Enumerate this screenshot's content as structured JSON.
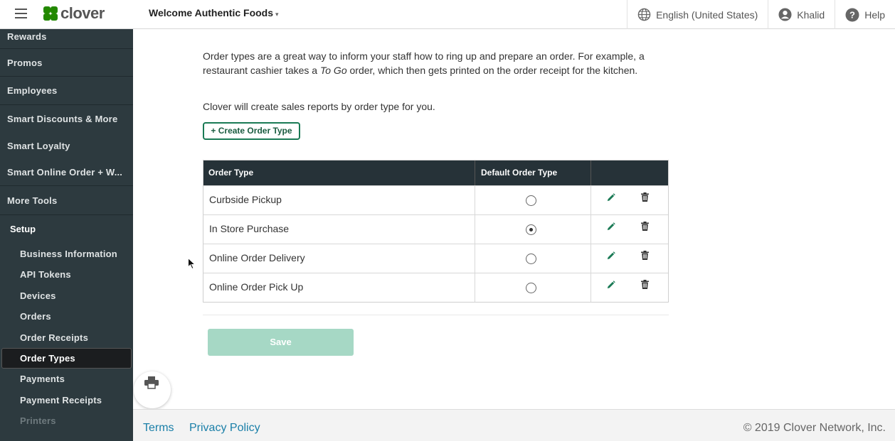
{
  "header": {
    "brand": "clover",
    "merchant_name": "Welcome Authentic Foods",
    "language": "English (United States)",
    "user": "Khalid",
    "help": "Help"
  },
  "sidebar": {
    "items": [
      {
        "label": "Rewards"
      },
      {
        "label": "Promos"
      },
      {
        "label": "Employees"
      },
      {
        "label": "Smart Discounts & More"
      },
      {
        "label": "Smart Loyalty"
      },
      {
        "label": "Smart Online Order + W..."
      },
      {
        "label": "More Tools"
      }
    ],
    "setup": {
      "label": "Setup",
      "sub_items": [
        {
          "label": "Business Information"
        },
        {
          "label": "API Tokens"
        },
        {
          "label": "Devices"
        },
        {
          "label": "Orders"
        },
        {
          "label": "Order Receipts"
        },
        {
          "label": "Order Types",
          "active": true
        },
        {
          "label": "Payments"
        },
        {
          "label": "Payment Receipts"
        },
        {
          "label": "Printers"
        }
      ]
    }
  },
  "main": {
    "intro_text_1": "Order types are a great way to inform your staff how to ring up and prepare an order. For example, a restaurant cashier takes a ",
    "intro_italic": "To Go",
    "intro_text_2": " order, which then gets printed on the order receipt for the kitchen.",
    "intro_2": "Clover will create sales reports by order type for you.",
    "create_button": "+ Create Order Type",
    "table": {
      "headers": [
        "Order Type",
        "Default Order Type",
        ""
      ],
      "rows": [
        {
          "name": "Curbside Pickup",
          "default": false
        },
        {
          "name": "In Store Purchase",
          "default": true
        },
        {
          "name": "Online Order Delivery",
          "default": false
        },
        {
          "name": "Online Order Pick Up",
          "default": false
        }
      ]
    },
    "save_button": "Save"
  },
  "footer": {
    "terms": "Terms",
    "privacy": "Privacy Policy",
    "copyright": "© 2019 Clover Network, Inc."
  },
  "colors": {
    "sidebar_bg": "#2d3a3f",
    "table_header_bg": "#263238",
    "accent_green": "#1a7a55",
    "save_disabled": "#a6d8c5",
    "link_blue": "#1a7fa8"
  }
}
